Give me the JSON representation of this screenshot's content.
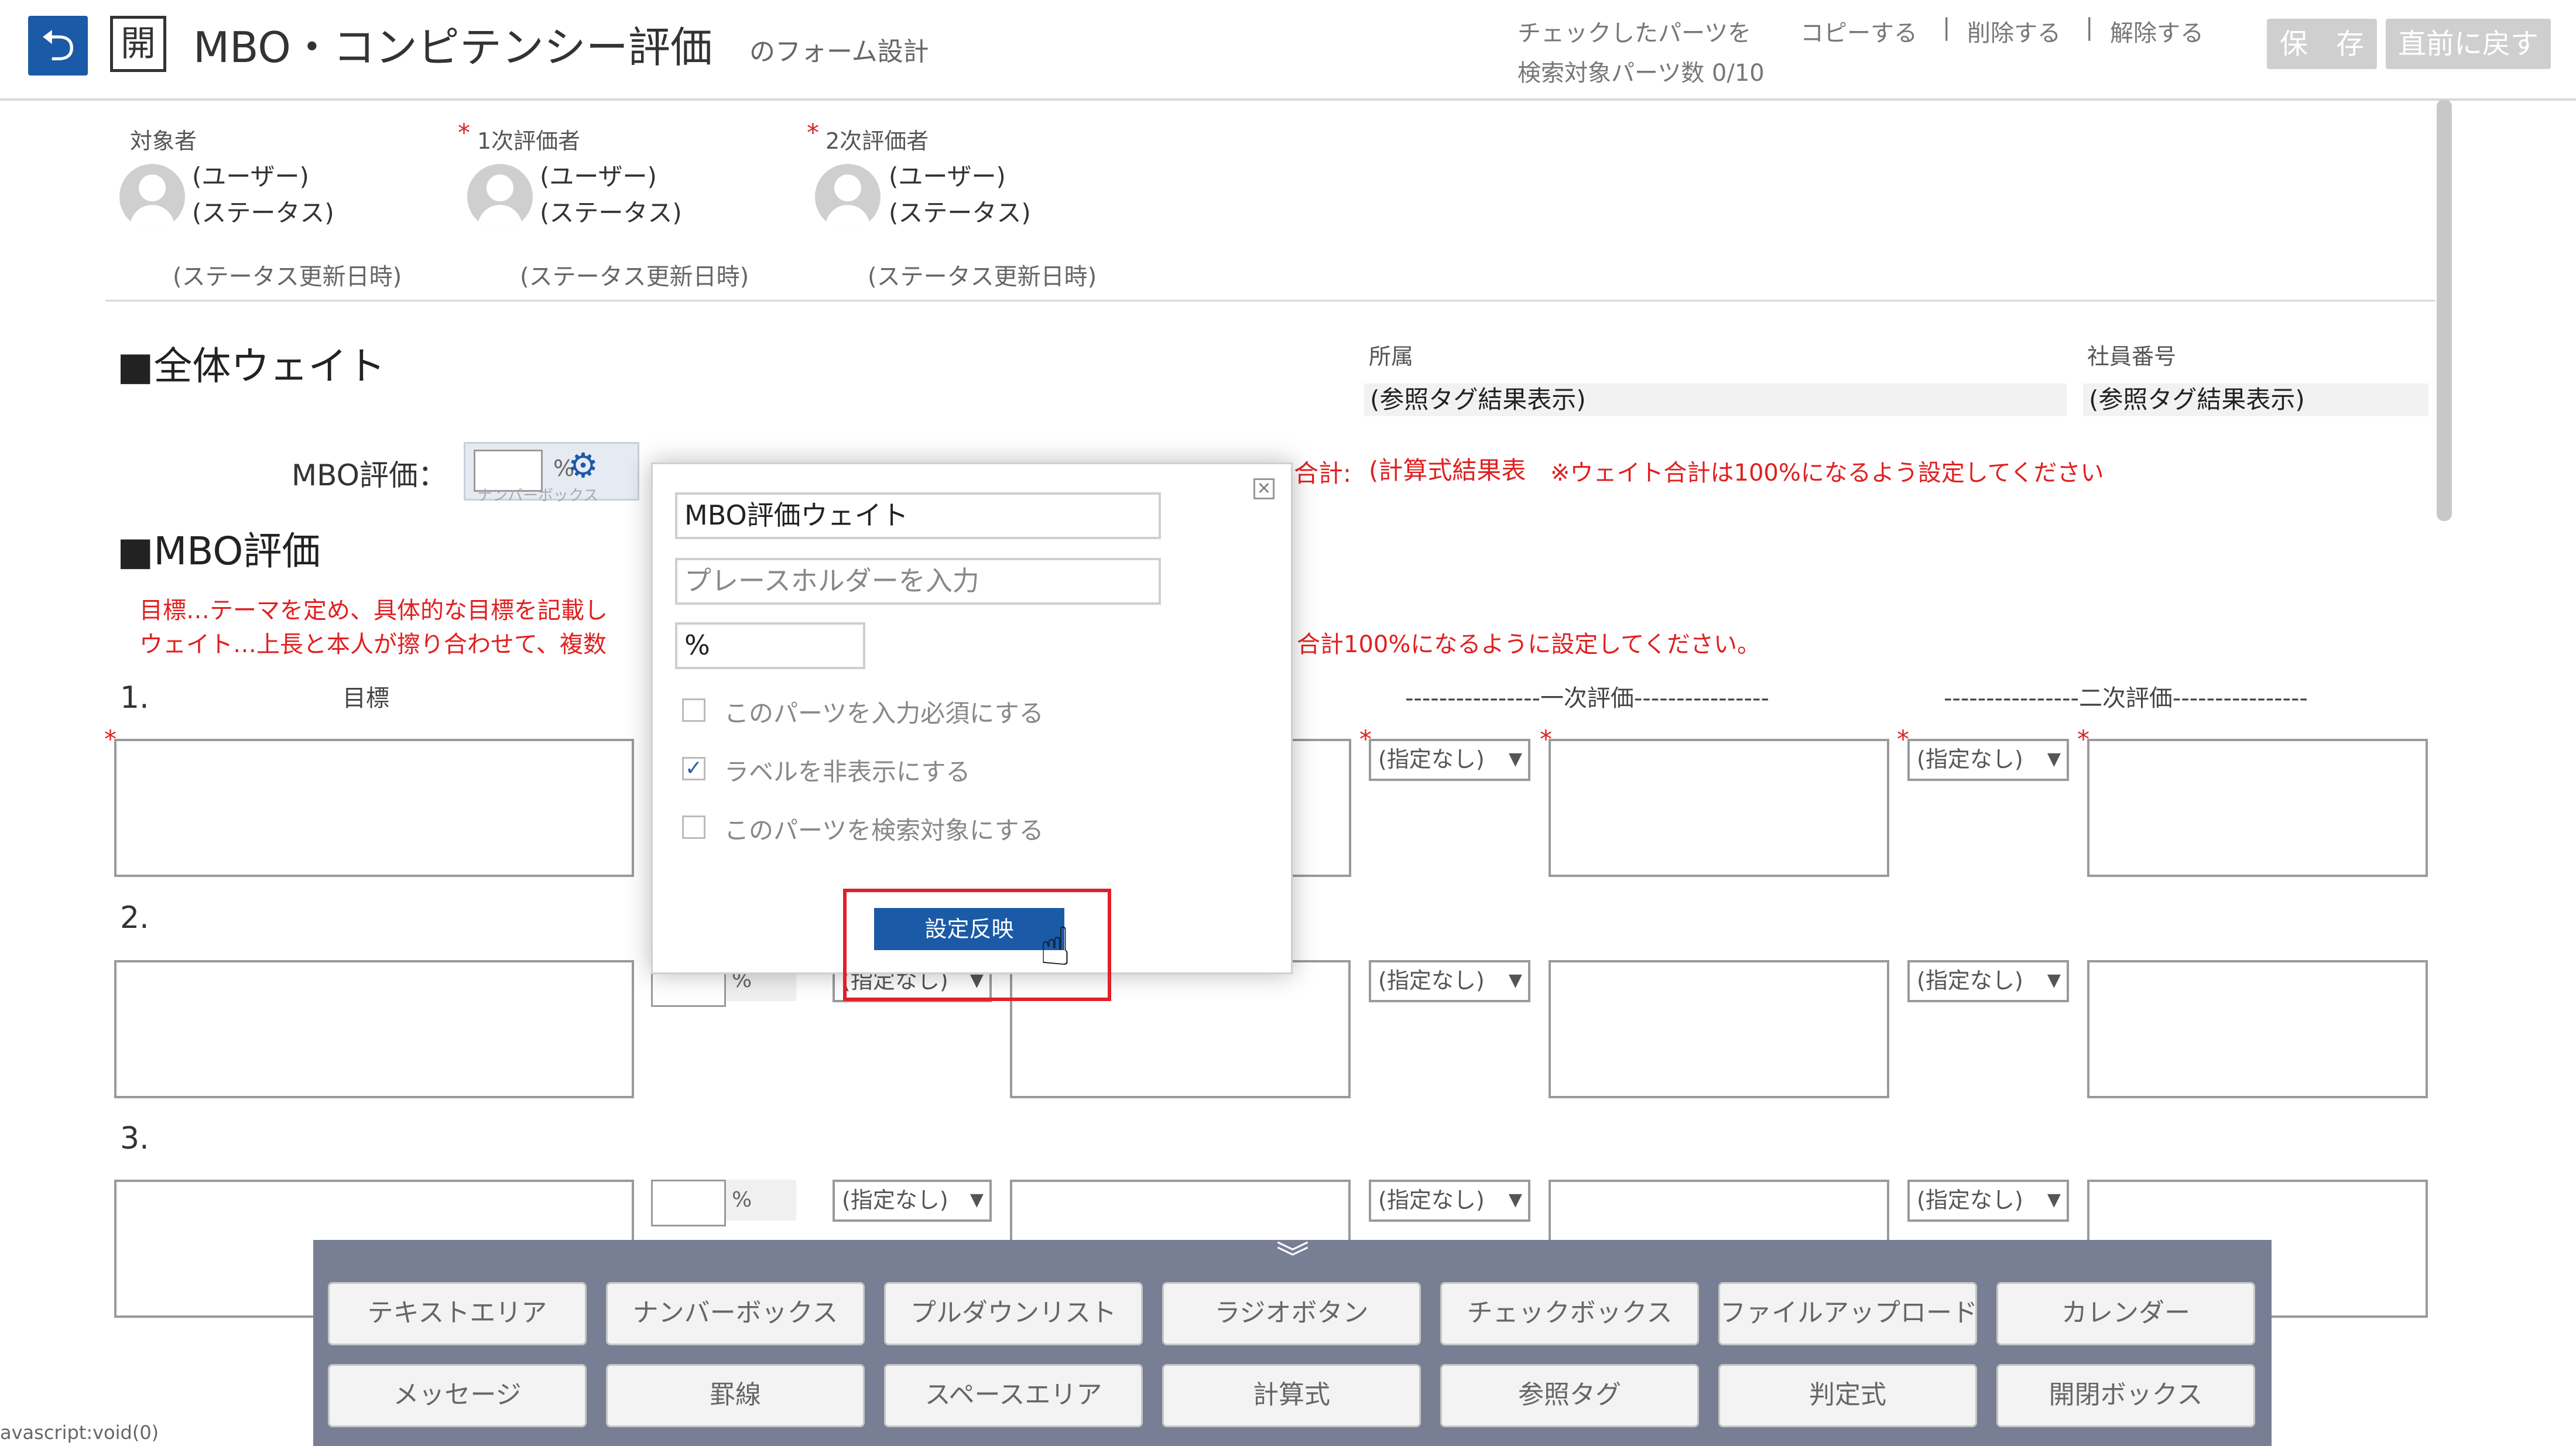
{
  "header": {
    "back_icon": "undo-arrow-icon",
    "open_label": "開",
    "title": "MBO・コンピテンシー評価",
    "subtitle": "のフォーム設計",
    "checked_parts": "チェックしたパーツを",
    "copy": "コピーする",
    "delete": "削除する",
    "release": "解除する",
    "separator": "|",
    "search_count": "検索対象パーツ数 0/10",
    "save": "保　存",
    "revert": "直前に戻す"
  },
  "evaluators": [
    {
      "label": "対象者",
      "required": false,
      "user": "(ユーザー)",
      "status": "(ステータス)",
      "date": "(ステータス更新日時)"
    },
    {
      "label": "1次評価者",
      "required": true,
      "user": "(ユーザー)",
      "status": "(ステータス)",
      "date": "(ステータス更新日時)"
    },
    {
      "label": "2次評価者",
      "required": true,
      "user": "(ユーザー)",
      "status": "(ステータス)",
      "date": "(ステータス更新日時)"
    }
  ],
  "required_mark": "*",
  "overall": {
    "title": "■全体ウェイト",
    "affiliation_label": "所属",
    "affiliation_value": "(参照タグ結果表示)",
    "employee_no_label": "社員番号",
    "employee_no_value": "(参照タグ結果表示)",
    "mbo_label": "MBO評価：",
    "pct": "%",
    "ghost_label": "ナンバーボックス",
    "total_label": "合計:",
    "total_value": "(計算式結果表",
    "total_note": "※ウェイト合計は100%になるよう設定してください"
  },
  "mbo": {
    "title": "■MBO評価",
    "desc1": "目標…テーマを定め、具体的な目標を記載し",
    "desc2": "ウェイト…上長と本人が擦り合わせて、複数",
    "desc_right": "合計100%になるように設定してください。",
    "col_goal": "目標",
    "col_first": "----------------一次評価----------------",
    "col_second": "----------------二次評価----------------",
    "rows": [
      "1.",
      "2.",
      "3."
    ],
    "select_default": "(指定なし)",
    "pct": "%"
  },
  "modal": {
    "label_value": "MBO評価ウェイト",
    "placeholder_text": "プレースホルダーを入力",
    "unit_value": "%",
    "options": [
      {
        "label": "このパーツを入力必須にする",
        "checked": false
      },
      {
        "label": "ラベルを非表示にする",
        "checked": true
      },
      {
        "label": "このパーツを検索対象にする",
        "checked": false
      }
    ],
    "apply": "設定反映",
    "close_glyph": "×",
    "check_glyph": "✓"
  },
  "palette": {
    "toggle_icon": "chevron-double-down-icon",
    "row1": [
      "テキストエリア",
      "ナンバーボックス",
      "プルダウンリスト",
      "ラジオボタン",
      "チェックボックス",
      "ファイルアップロード",
      "カレンダー"
    ],
    "row2": [
      "メッセージ",
      "罫線",
      "スペースエリア",
      "計算式",
      "参照タグ",
      "判定式",
      "開閉ボックス"
    ]
  },
  "statusbar": "avascript:void(0)"
}
